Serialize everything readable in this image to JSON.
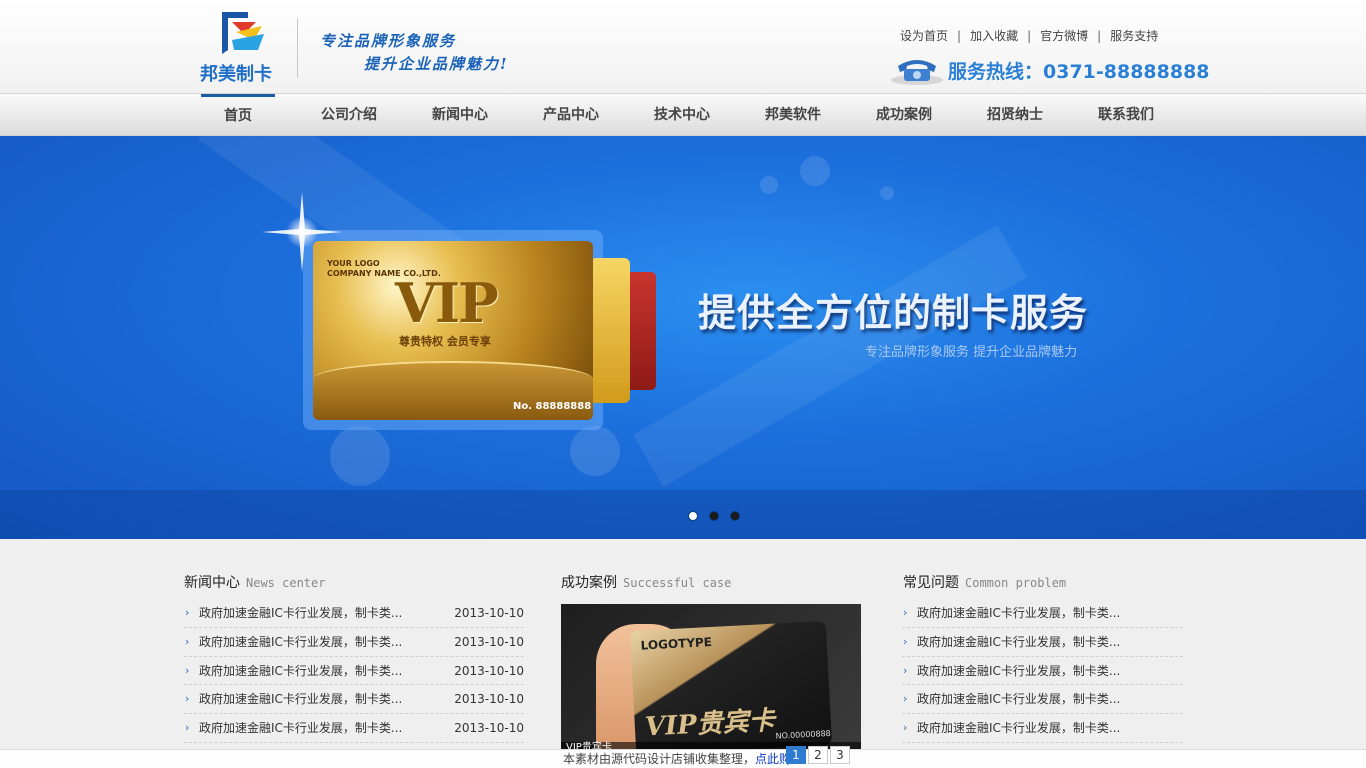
{
  "header": {
    "logo_text": "邦美制卡",
    "slogan_line1": "专注品牌形象服务",
    "slogan_line2": "提升企业品牌魅力!",
    "top_links": [
      "设为首页",
      "加入收藏",
      "官方微博",
      "服务支持"
    ],
    "hotline": "服务热线：0371-88888888"
  },
  "nav": {
    "items": [
      "首页",
      "公司介绍",
      "新闻中心",
      "产品中心",
      "技术中心",
      "邦美软件",
      "成功案例",
      "招贤纳士",
      "联系我们"
    ],
    "active_index": 0
  },
  "banner": {
    "title": "提供全方位的制卡服务",
    "subtitle": "专注品牌形象服务 提升企业品牌魅力",
    "card": {
      "logo_line1": "YOUR LOGO",
      "logo_line2": "COMPANY NAME CO.,LTD.",
      "vip": "VIP",
      "sub": "尊贵特权 会员专享",
      "number": "No. 88888888"
    },
    "slide_count": 3,
    "active_slide": 0
  },
  "news": {
    "title": "新闻中心",
    "title_en": "News center",
    "items": [
      {
        "text": "政府加速金融IC卡行业发展，制卡类...",
        "date": "2013-10-10"
      },
      {
        "text": "政府加速金融IC卡行业发展，制卡类...",
        "date": "2013-10-10"
      },
      {
        "text": "政府加速金融IC卡行业发展，制卡类...",
        "date": "2013-10-10"
      },
      {
        "text": "政府加速金融IC卡行业发展，制卡类...",
        "date": "2013-10-10"
      },
      {
        "text": "政府加速金融IC卡行业发展，制卡类...",
        "date": "2013-10-10"
      }
    ]
  },
  "cases": {
    "title": "成功案例",
    "title_en": "Successful case",
    "image": {
      "logo": "LOGOTYPE",
      "vip": "VIP贵宾卡",
      "number": "NO.00000888",
      "caption": "VIP贵宾卡"
    },
    "pages": [
      "1",
      "2",
      "3"
    ],
    "active_page": 0
  },
  "faq": {
    "title": "常见问题",
    "title_en": "Common problem",
    "items": [
      "政府加速金融IC卡行业发展，制卡类...",
      "政府加速金融IC卡行业发展，制卡类...",
      "政府加速金融IC卡行业发展，制卡类...",
      "政府加速金融IC卡行业发展，制卡类...",
      "政府加速金融IC卡行业发展，制卡类..."
    ]
  },
  "footer": {
    "notice": "本素材由源代码设计店铺收集整理，",
    "buy_link": "点此购买"
  }
}
